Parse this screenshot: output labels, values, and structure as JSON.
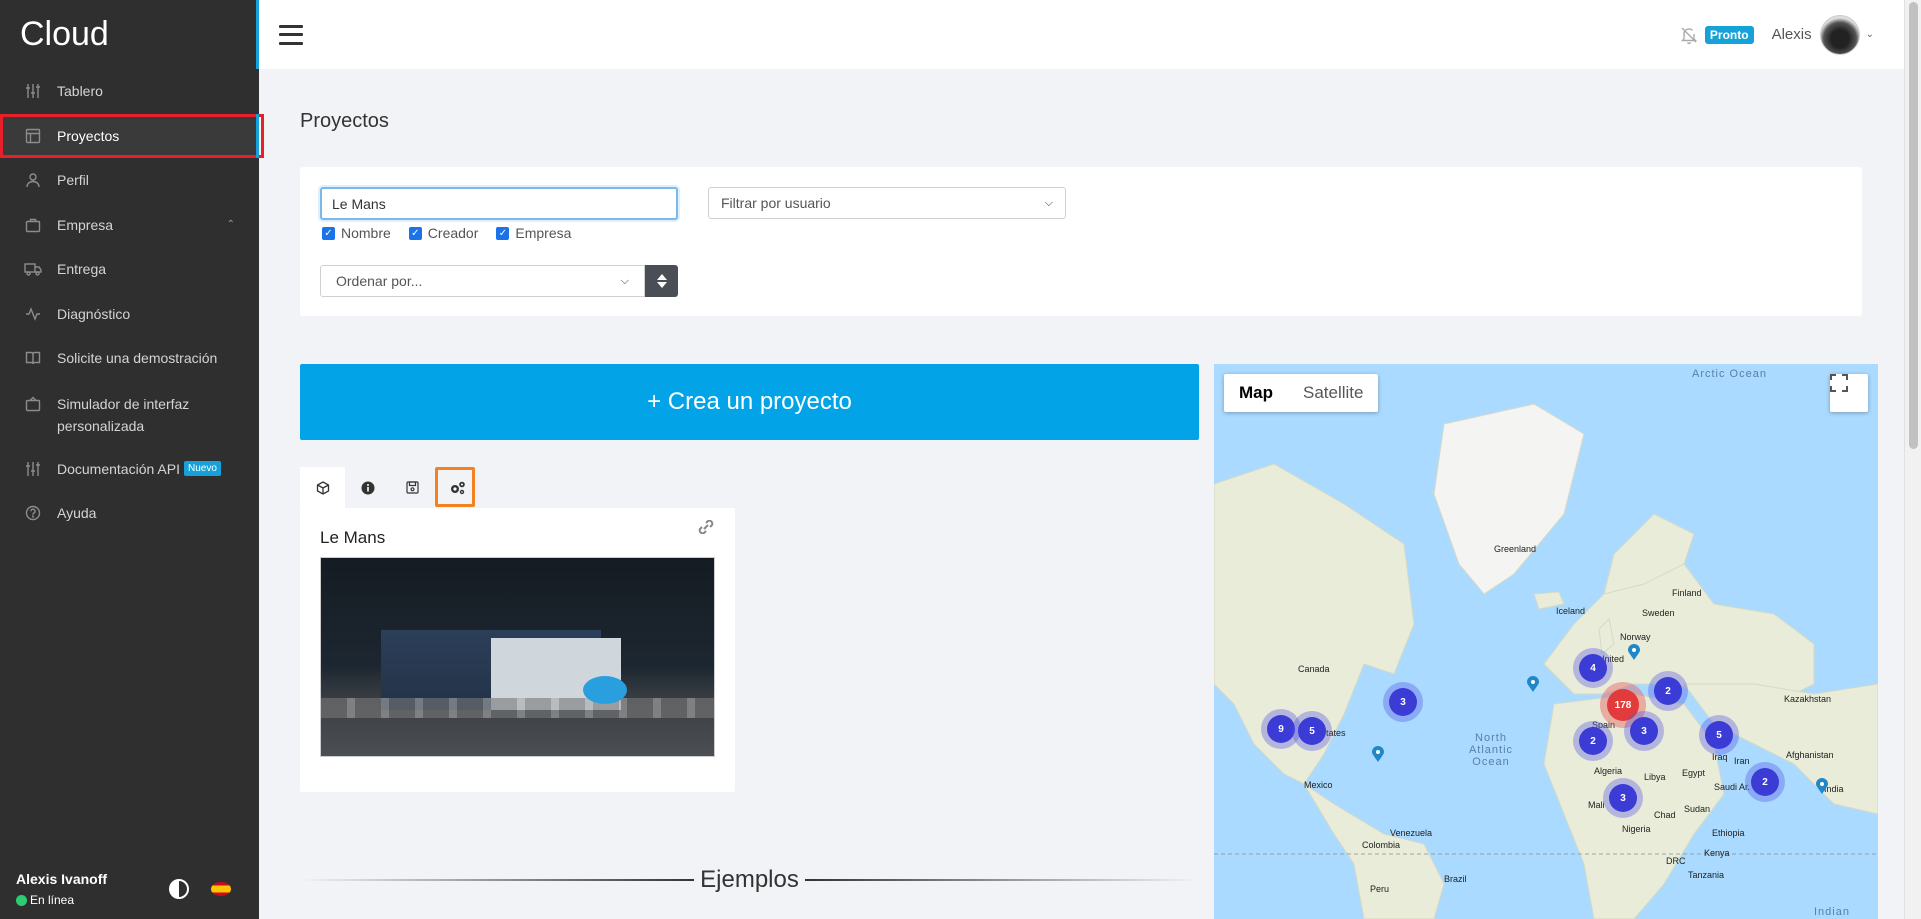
{
  "sidebar": {
    "brand": "Cloud",
    "items": [
      {
        "label": "Tablero"
      },
      {
        "label": "Proyectos"
      },
      {
        "label": "Perfil"
      },
      {
        "label": "Empresa"
      },
      {
        "label": "Entrega"
      },
      {
        "label": "Diagnóstico"
      },
      {
        "label": "Solicite una demostración"
      },
      {
        "label": "Simulador de interfaz personalizada"
      },
      {
        "label": "Documentación API",
        "badge": "Nuevo"
      },
      {
        "label": "Ayuda"
      }
    ],
    "footer": {
      "user": "Alexis Ivanoff",
      "status": "En línea"
    }
  },
  "topbar": {
    "soon_badge": "Pronto",
    "username": "Alexis"
  },
  "page": {
    "title": "Proyectos"
  },
  "filters": {
    "search_value": "Le Mans",
    "checkboxes": [
      "Nombre",
      "Creador",
      "Empresa"
    ],
    "user_filter": "Filtrar por usuario",
    "order_by": "Ordenar por..."
  },
  "create_button": "+ Crea un proyecto",
  "project": {
    "name": "Le Mans"
  },
  "examples_heading": "Ejemplos",
  "map": {
    "types": [
      "Map",
      "Satellite"
    ],
    "labels": {
      "arctic": "Arctic Ocean",
      "greenland": "Greenland",
      "iceland": "Iceland",
      "finland": "Finland",
      "sweden": "Sweden",
      "norway": "Norway",
      "canada": "Canada",
      "kazakhstan": "Kazakhstan",
      "atlantic": "North Atlantic Ocean",
      "mexico": "Mexico",
      "algeria": "Algeria",
      "libya": "Libya",
      "egypt": "Egypt",
      "iran": "Iran",
      "iraq": "Iraq",
      "saudi": "Saudi Ar.",
      "afghanistan": "Afghanistan",
      "india": "India",
      "sudan": "Sudan",
      "chad": "Chad",
      "mali": "Mali",
      "nigeria": "Nigeria",
      "ethiopia": "Ethiopia",
      "kenya": "Kenya",
      "drc": "DRC",
      "tanzania": "Tanzania",
      "venezuela": "Venezuela",
      "colombia": "Colombia",
      "brazil": "Brazil",
      "peru": "Peru",
      "spain": "Spain",
      "united": "United",
      "states": "States",
      "indian": "Indian"
    },
    "clusters": [
      "9",
      "5",
      "3",
      "4",
      "178",
      "2",
      "3",
      "2",
      "5",
      "3",
      "2"
    ]
  }
}
